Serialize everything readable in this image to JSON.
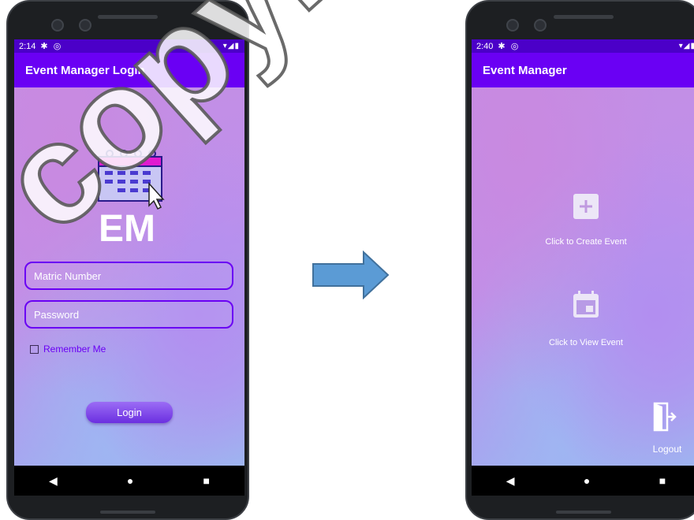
{
  "left_screen": {
    "status_time": "2:14",
    "status_icons": "✱ ◎",
    "status_right": "▾◢▮",
    "app_title": "Event Manager Login",
    "logo_text": "EM",
    "matric_placeholder": "Matric Number",
    "password_placeholder": "Password",
    "remember_label": "Remember Me",
    "remember_checked": false,
    "login_label": "Login"
  },
  "right_screen": {
    "status_time": "2:40",
    "status_icons": "✱ ◎",
    "status_right": "▾◢▮",
    "app_title": "Event Manager",
    "create_label": "Click to Create Event",
    "view_label": "Click to View Event",
    "logout_label": "Logout"
  },
  "nav_buttons": {
    "back": "◀",
    "home": "●",
    "recents": "■"
  },
  "icons": {
    "logo": "calendar-cursor-icon",
    "create": "plus-icon",
    "view": "calendar-icon",
    "logout": "logout-door-icon",
    "transition": "right-arrow-icon"
  },
  "colors": {
    "app_bar": "#6a00f4",
    "status_bar": "#4b00c8",
    "field_border": "#6a00f4",
    "arrow_fill": "#5b9bd5",
    "arrow_stroke": "#41719c"
  },
  "watermark_text": "copyright@"
}
